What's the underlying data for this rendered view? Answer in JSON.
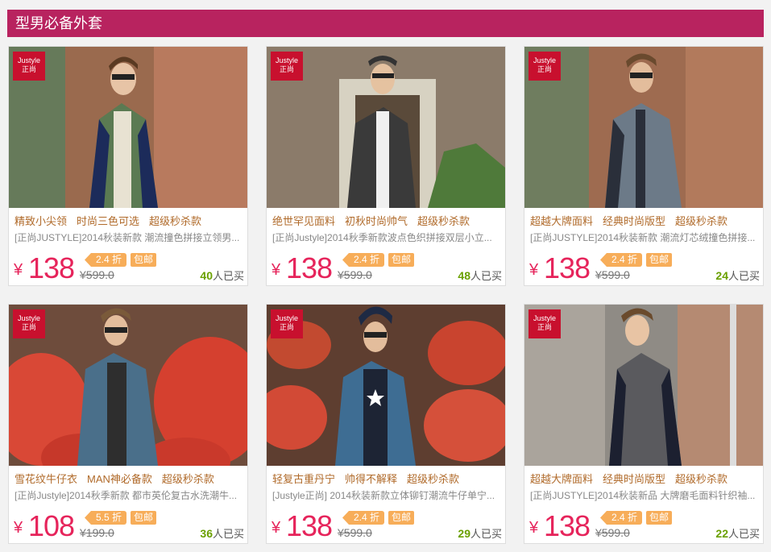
{
  "header": {
    "title": "型男必备外套"
  },
  "colors": {
    "header_bg": "#b8235f",
    "price": "#e6245b",
    "tag": "#f7ad59",
    "title": "#b06a2a",
    "sold_count": "#6aa000"
  },
  "brand": {
    "logo_en": "Justyle",
    "logo_zh": "正尚"
  },
  "products": [
    {
      "title_parts": [
        "精致小尖领",
        "时尚三色可选",
        "超级秒杀款"
      ],
      "desc": "[正尚JUSTYLE]2014秋装新款 潮流撞色拼接立领男...",
      "currency": "¥",
      "price": "138",
      "discount": "2.4 折",
      "shipping": "包邮",
      "original_price": "¥599.0",
      "sold_count": "40",
      "sold_suffix": "人已买"
    },
    {
      "title_parts": [
        "绝世罕见面料",
        "初秋时尚帅气",
        "超级秒杀款"
      ],
      "desc": "[正尚Justyle]2014秋季新款波点色织拼接双层小立...",
      "currency": "¥",
      "price": "138",
      "discount": "2.4 折",
      "shipping": "包邮",
      "original_price": "¥599.0",
      "sold_count": "48",
      "sold_suffix": "人已买"
    },
    {
      "title_parts": [
        "超越大牌面料",
        "经典时尚版型",
        "超级秒杀款"
      ],
      "desc": "[正尚JUSTYLE]2014秋装新款 潮流灯芯绒撞色拼接...",
      "currency": "¥",
      "price": "138",
      "discount": "2.4 折",
      "shipping": "包邮",
      "original_price": "¥599.0",
      "sold_count": "24",
      "sold_suffix": "人已买"
    },
    {
      "title_parts": [
        "雪花纹牛仔衣",
        "MAN神必备款",
        "超级秒杀款"
      ],
      "desc": "[正尚Justyle]2014秋季新款 都市英伦复古水洗潮牛...",
      "currency": "¥",
      "price": "108",
      "discount": "5.5 折",
      "shipping": "包邮",
      "original_price": "¥199.0",
      "sold_count": "36",
      "sold_suffix": "人已买"
    },
    {
      "title_parts": [
        "轻复古重丹宁",
        "帅得不解释",
        "超级秒杀款"
      ],
      "desc": "[Justyle正尚] 2014秋装新款立体铆钉潮流牛仔单宁...",
      "currency": "¥",
      "price": "138",
      "discount": "2.4 折",
      "shipping": "包邮",
      "original_price": "¥599.0",
      "sold_count": "29",
      "sold_suffix": "人已买"
    },
    {
      "title_parts": [
        "超越大牌面料",
        "经典时尚版型",
        "超级秒杀款"
      ],
      "desc": "[正尚JUSTYLE]2014秋装新品 大牌磨毛面料针织袖...",
      "currency": "¥",
      "price": "138",
      "discount": "2.4 折",
      "shipping": "包邮",
      "original_price": "¥599.0",
      "sold_count": "22",
      "sold_suffix": "人已买"
    }
  ]
}
